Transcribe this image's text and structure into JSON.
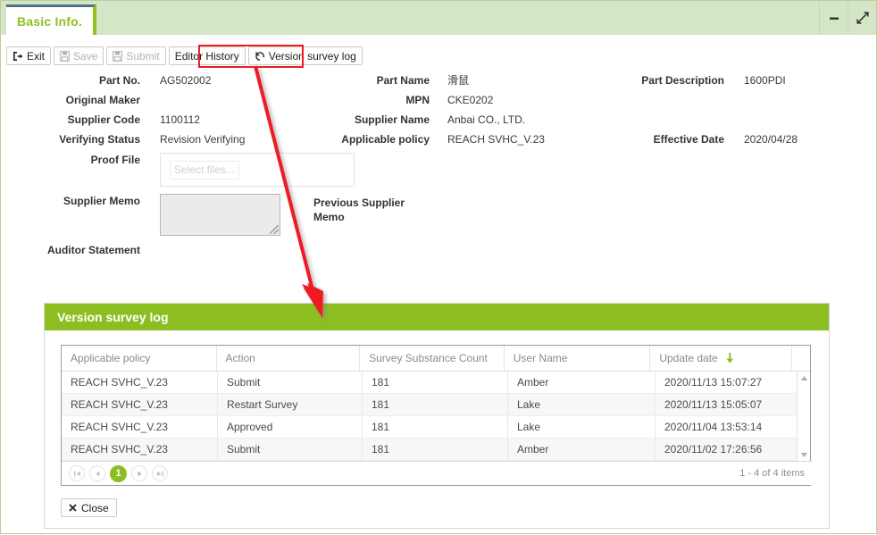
{
  "window": {
    "minimize_label": "−",
    "expand_label": "⤢"
  },
  "tabs": [
    {
      "label": "Basic Info."
    }
  ],
  "toolbar": {
    "exit_label": "Exit",
    "save_label": "Save",
    "submit_label": "Submit",
    "editor_history_label": "Editor History",
    "version_survey_log_label": "Version survey log"
  },
  "form": {
    "part_no": {
      "label": "Part No.",
      "value": "AG502002"
    },
    "original_maker": {
      "label": "Original Maker",
      "value": ""
    },
    "supplier_code": {
      "label": "Supplier Code",
      "value": "1100112"
    },
    "verifying_status": {
      "label": "Verifying Status",
      "value": "Revision Verifying"
    },
    "proof_file": {
      "label": "Proof File",
      "button": "Select files..."
    },
    "supplier_memo": {
      "label": "Supplier Memo",
      "value": ""
    },
    "auditor_statement": {
      "label": "Auditor Statement",
      "value": ""
    },
    "part_name": {
      "label": "Part Name",
      "value": "滑鼠"
    },
    "mpn": {
      "label": "MPN",
      "value": "CKE0202"
    },
    "supplier_name": {
      "label": "Supplier Name",
      "value": "Anbai CO., LTD."
    },
    "applicable_policy": {
      "label": "Applicable policy",
      "value": "REACH SVHC_V.23"
    },
    "previous_supplier_memo": {
      "label": "Previous Supplier Memo",
      "value": ""
    },
    "part_description": {
      "label": "Part Description",
      "value": "1600PDI"
    },
    "effective_date": {
      "label": "Effective Date",
      "value": "2020/04/28"
    }
  },
  "version_survey_log": {
    "title": "Version survey log",
    "columns": [
      "Applicable policy",
      "Action",
      "Survey Substance Count",
      "User Name",
      "Update date"
    ],
    "sort_column": "Update date",
    "sort_direction": "desc",
    "rows": [
      {
        "policy": "REACH SVHC_V.23",
        "action": "Submit",
        "count": "181",
        "user": "Amber",
        "date": "2020/11/13 15:07:27"
      },
      {
        "policy": "REACH SVHC_V.23",
        "action": "Restart Survey",
        "count": "181",
        "user": "Lake",
        "date": "2020/11/13 15:05:07"
      },
      {
        "policy": "REACH SVHC_V.23",
        "action": "Approved",
        "count": "181",
        "user": "Lake",
        "date": "2020/11/04 13:53:14"
      },
      {
        "policy": "REACH SVHC_V.23",
        "action": "Submit",
        "count": "181",
        "user": "Amber",
        "date": "2020/11/02 17:26:56"
      }
    ],
    "pager": {
      "first": "⏮",
      "prev": "◀",
      "current_page": "1",
      "next": "▶",
      "last": "⏭",
      "info": "1 - 4 of 4 items"
    },
    "close_label": "Close"
  },
  "colors": {
    "brand_green": "#8cbe22",
    "titlebar_green": "#d5e6c6",
    "tab_text_green": "#8fbe1e",
    "tab_top_blue": "#4d7186",
    "annotation_red": "#ee1c22"
  }
}
